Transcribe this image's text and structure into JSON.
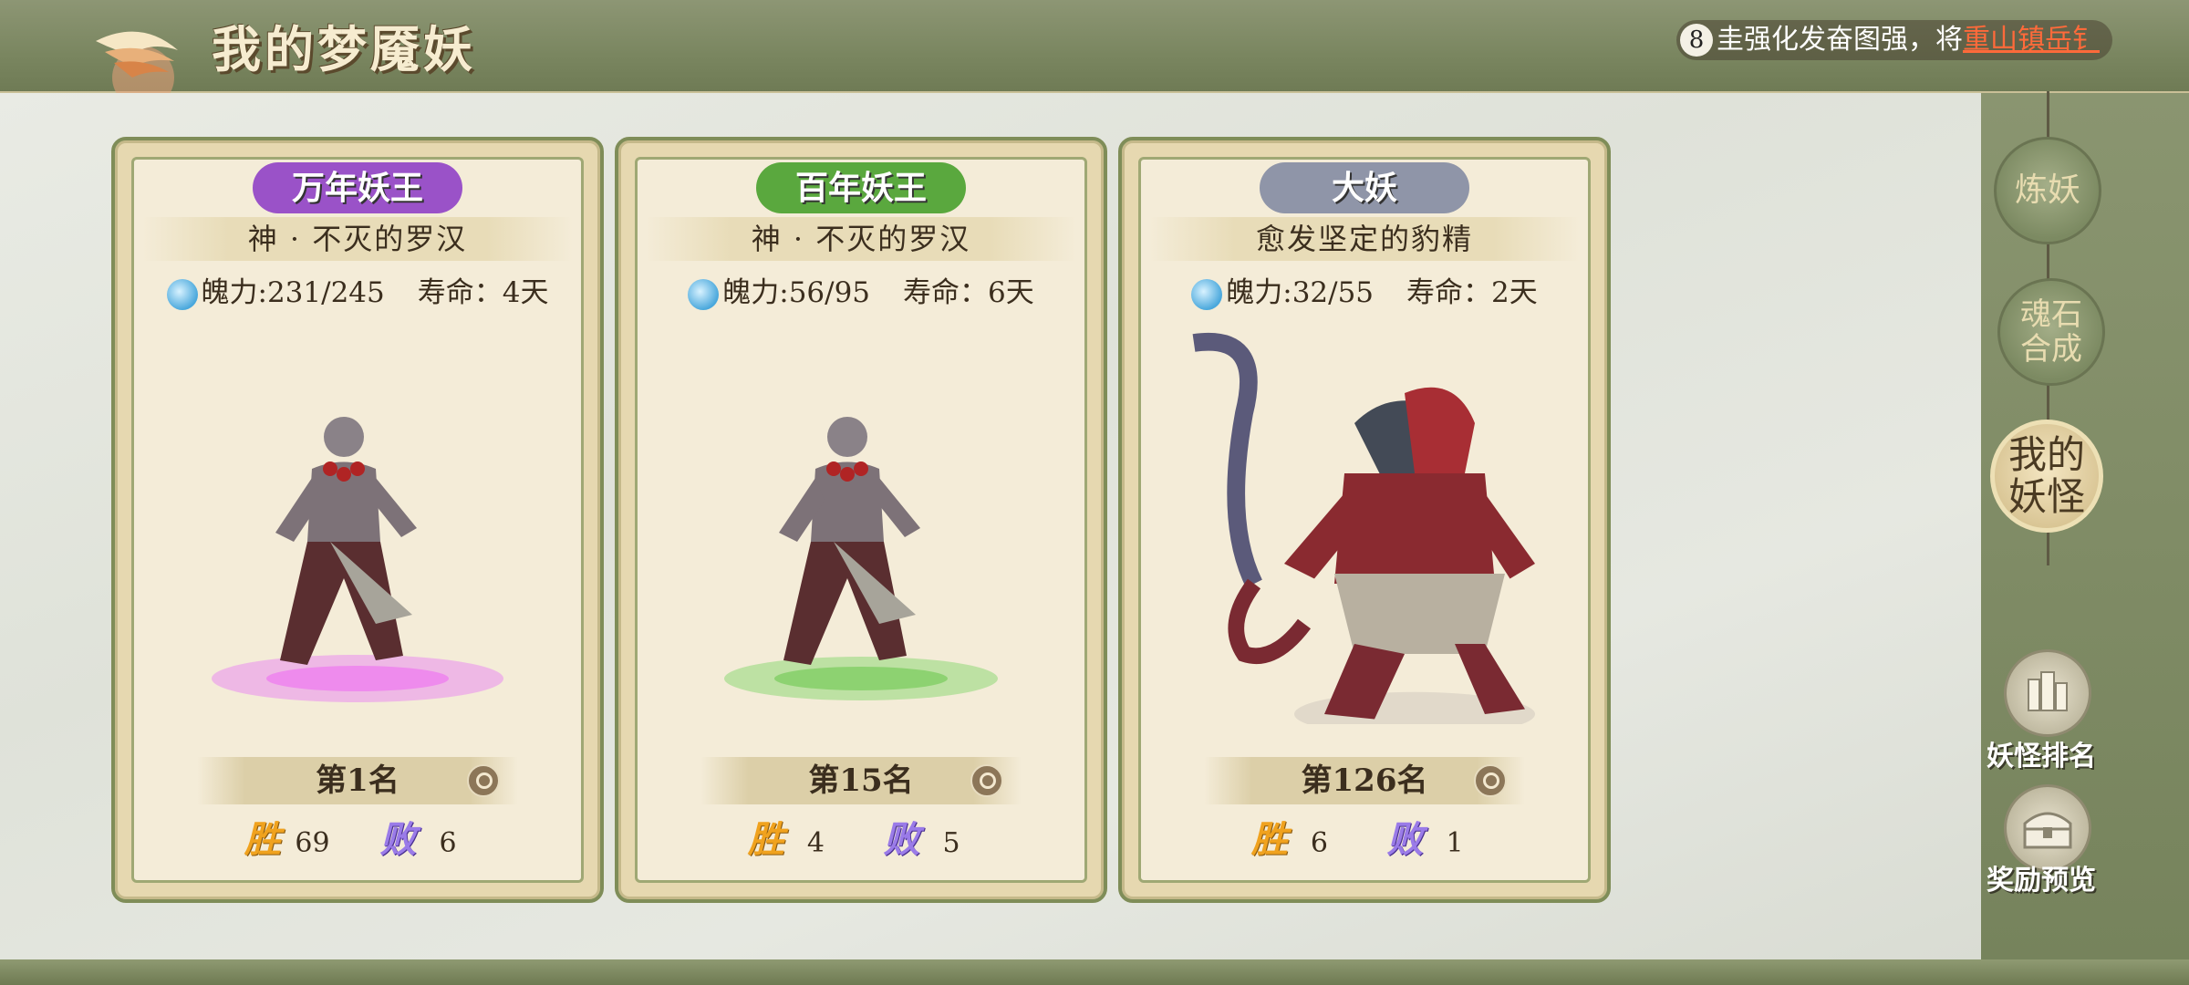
{
  "header": {
    "title": "我的梦魇妖",
    "marquee": {
      "badge": "8",
      "text": "圭强化发奋图强，将",
      "link_text": "重山镇岳钅"
    }
  },
  "sidebar": {
    "buttons": [
      {
        "label": "炼妖"
      },
      {
        "label_line1": "魂石",
        "label_line2": "合成"
      },
      {
        "label_line1": "我的",
        "label_line2": "妖怪"
      }
    ],
    "actions": [
      {
        "label": "妖怪排名",
        "icon": "ranking-icon"
      },
      {
        "label": "奖励预览",
        "icon": "reward-chest-icon"
      }
    ]
  },
  "cards": [
    {
      "tier": "万年妖王",
      "tier_color": "#9a52c8",
      "name": "神 · 不灭的罗汉",
      "soul_label": "魄力:",
      "soul_value": "231/245",
      "life_label": "寿命：",
      "life_value": "4天",
      "rank": "第1名",
      "win_label": "胜",
      "wins": "69",
      "lose_label": "败",
      "losses": "6",
      "aura_color": "#e98ef0"
    },
    {
      "tier": "百年妖王",
      "tier_color": "#5aa83e",
      "name": "神 · 不灭的罗汉",
      "soul_label": "魄力:",
      "soul_value": "56/95",
      "life_label": "寿命：",
      "life_value": "6天",
      "rank": "第15名",
      "win_label": "胜",
      "wins": "4",
      "lose_label": "败",
      "losses": "5",
      "aura_color": "#8fd878"
    },
    {
      "tier": "大妖",
      "tier_color": "#8f95a8",
      "name": "愈发坚定的豹精",
      "soul_label": "魄力:",
      "soul_value": "32/55",
      "life_label": "寿命：",
      "life_value": "2天",
      "rank": "第126名",
      "win_label": "胜",
      "wins": "6",
      "lose_label": "败",
      "losses": "1",
      "aura_color": "#d8d2c4"
    }
  ]
}
